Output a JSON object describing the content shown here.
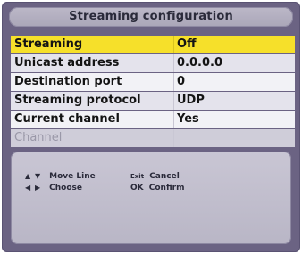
{
  "title": "Streaming configuration",
  "menu": {
    "items": [
      {
        "label": "Streaming",
        "value": "Off"
      },
      {
        "label": "Unicast address",
        "value": "0.0.0.0"
      },
      {
        "label": "Destination port",
        "value": "0"
      },
      {
        "label": "Streaming protocol",
        "value": "UDP"
      },
      {
        "label": "Current channel",
        "value": "Yes"
      },
      {
        "label": "Channel",
        "value": ""
      }
    ]
  },
  "help": {
    "move_keys": "▲ ▼",
    "move_label": "Move Line",
    "choose_keys": "◀ ▶",
    "choose_label": "Choose",
    "exit_key": "Exit",
    "exit_label": "Cancel",
    "ok_key": "OK",
    "ok_label": "Confirm"
  },
  "colors": {
    "selection": "#f6e02a",
    "frame": "#6b6383",
    "panel": "#c9c6d4"
  }
}
